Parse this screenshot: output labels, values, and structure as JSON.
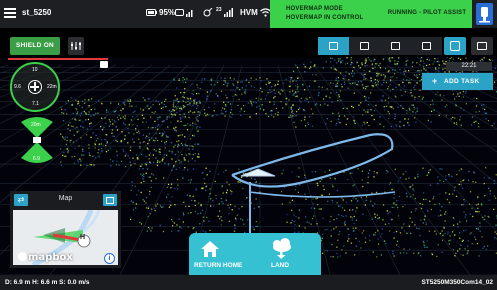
{
  "topbar": {
    "device_name": "st_5250",
    "battery": "95%",
    "rc_signal": "",
    "satellites_sup": "23",
    "mode_label": "HVM",
    "mode_box_line1": "HOVERMAP MODE",
    "mode_box_line2": "HOVERMAP IN CONTROL",
    "status": "RUNNING - PILOT ASSIST"
  },
  "toolbar": {
    "shield_label": "SHIELD ON"
  },
  "hud": {
    "clock": "22:21",
    "add_task_label": "ADD TASK"
  },
  "attitude": {
    "top": "10",
    "left": "9.6",
    "right": "22m",
    "bottom": "7.1"
  },
  "fan": {
    "top": "20m",
    "bottom": "6.9"
  },
  "map": {
    "title": "Map",
    "marker": "H",
    "logo": "mapbox",
    "info": "i"
  },
  "actions": {
    "return_home_label": "RETURN HOME",
    "land_label": "LAND"
  },
  "status_bar": {
    "telemetry": "D: 6.9 m  H: 6.6 m  S: 0.0 m/s",
    "drone_id": "ST5250M350Com14_02"
  },
  "colors": {
    "green": "#3bd14a",
    "cyan": "#2aa3c7",
    "teal_panel": "#36c1d2",
    "blue": "#2a6ed8",
    "dark": "#1e1f22"
  }
}
